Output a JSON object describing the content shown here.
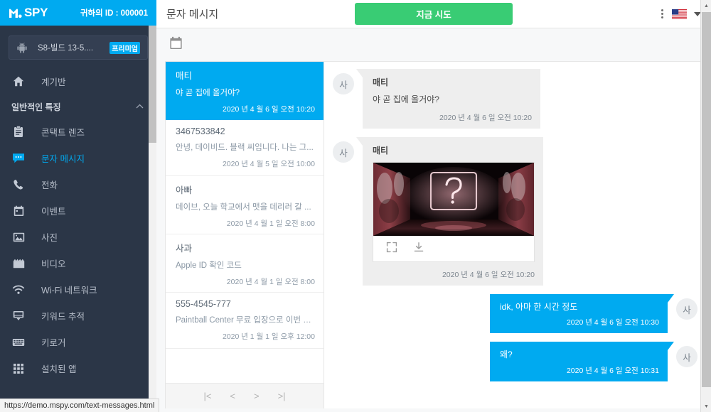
{
  "sidebar": {
    "logo": "mSPY",
    "logo_mark": "M.",
    "logo_rest": "SPY",
    "user_id": "귀하의 ID : 000001",
    "device": {
      "name": "S8-빌드 13-5....",
      "badge": "프리미엄",
      "icon": "android-icon"
    },
    "items": [
      {
        "label": "계기반",
        "icon": "home-icon",
        "active": false
      },
      {
        "label": "콘택트 렌즈",
        "icon": "contacts-icon",
        "active": false
      },
      {
        "label": "문자 메시지",
        "icon": "message-icon",
        "active": true
      },
      {
        "label": "전화",
        "icon": "phone-icon",
        "active": false
      },
      {
        "label": "이벤트",
        "icon": "calendar-icon",
        "active": false
      },
      {
        "label": "사진",
        "icon": "photo-icon",
        "active": false
      },
      {
        "label": "비디오",
        "icon": "video-icon",
        "active": false
      },
      {
        "label": "Wi-Fi 네트워크",
        "icon": "wifi-icon",
        "active": false
      },
      {
        "label": "키워드 추적",
        "icon": "keyword-icon",
        "active": false
      },
      {
        "label": "키로거",
        "icon": "keyboard-icon",
        "active": false
      },
      {
        "label": "설치된 앱",
        "icon": "apps-grid-icon",
        "active": false
      }
    ],
    "section_label": "일반적인 특징"
  },
  "topbar": {
    "title": "문자 메시지",
    "try_button": "지금 시도",
    "kebab_icon": "more-vertical-icon",
    "flag_icon": "us-flag-icon",
    "caret_icon": "chevron-down-icon"
  },
  "toolbar": {
    "calendar_icon": "calendar-icon"
  },
  "conversations": [
    {
      "name": "매티",
      "preview": "야 곧 집에 올거야?",
      "time": "2020 년 4 월 6 일 오전 10:20",
      "selected": true
    },
    {
      "name": "3467533842",
      "preview": "안녕, 데이비드. 블랙 씨입니다. 나는 그...",
      "time": "2020 년 4 월 5 일 오전 10:00",
      "selected": false
    },
    {
      "name": "아빠",
      "preview": "데이브, 오늘 학교에서 맷을 데리러 갈 ...",
      "time": "2020 년 4 월 1 일 오전 8:00",
      "selected": false
    },
    {
      "name": "사과",
      "preview": "Apple ID 확인 코드",
      "time": "2020 년 4 월 1 일 오전 8:00",
      "selected": false
    },
    {
      "name": "555-4545-777",
      "preview": "Paintball Center 무료 입장으로 이번 여...",
      "time": "2020 년 1 월 1 일 오후 12:00",
      "selected": false
    }
  ],
  "pager": {
    "first": "|<",
    "prev": "<",
    "next": ">",
    "last": ">|"
  },
  "messages": [
    {
      "kind": "text",
      "direction": "in",
      "avatar": "사",
      "sender": "매티",
      "text": "야 곧 집에 올거야?",
      "time": "2020 년 4 월 6 일 오전 10:20"
    },
    {
      "kind": "media",
      "direction": "in",
      "avatar": "사",
      "sender": "매티",
      "media_alt": "dark-corridor-question-mark-photo",
      "expand_icon": "expand-icon",
      "download_icon": "download-icon",
      "time": "2020 년 4 월 6 일 오전 10:20"
    },
    {
      "kind": "text",
      "direction": "out",
      "avatar": "사",
      "text": "idk, 아마 한 시간 정도",
      "time": "2020 년 4 월 6 일 오전 10:30"
    },
    {
      "kind": "text",
      "direction": "out",
      "avatar": "사",
      "text": "왜?",
      "time": "2020 년 4 월 6 일 오전 10:31"
    }
  ],
  "status_bar": {
    "url": "https://demo.mspy.com/text-messages.html"
  },
  "colors": {
    "brand_blue": "#00aaf0",
    "sidebar_bg": "#2b3647",
    "green_cta": "#39cc74",
    "bubble_grey": "#eeeeee"
  }
}
